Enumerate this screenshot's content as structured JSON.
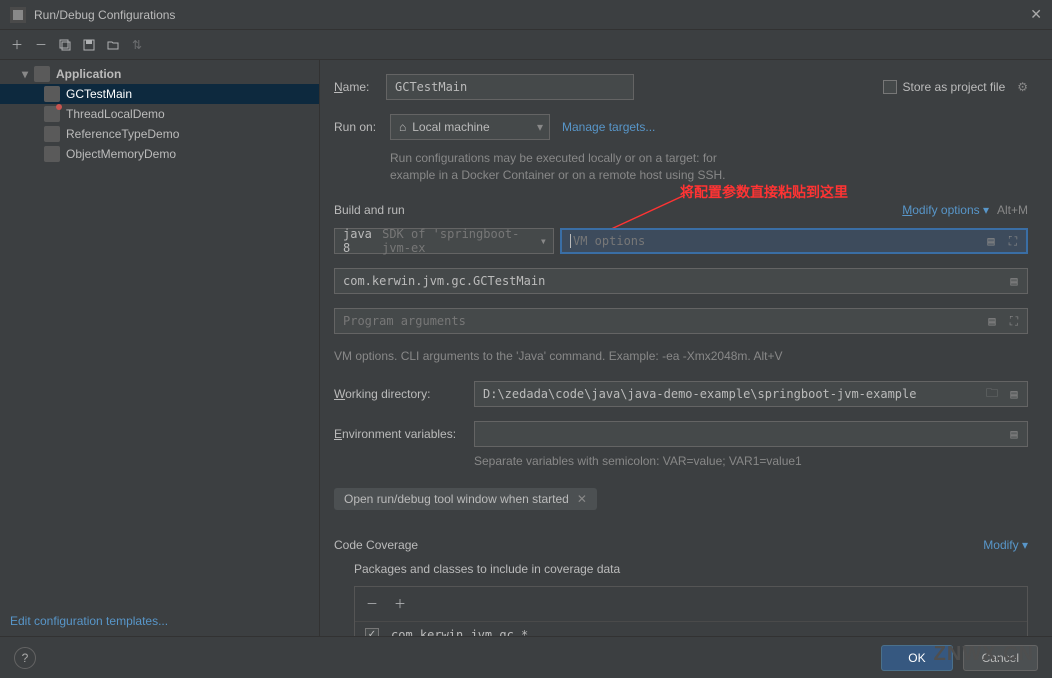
{
  "titlebar": {
    "title": "Run/Debug Configurations"
  },
  "tree": {
    "root": "Application",
    "items": [
      "GCTestMain",
      "ThreadLocalDemo",
      "ReferenceTypeDemo",
      "ObjectMemoryDemo"
    ]
  },
  "name": {
    "label": "Name:",
    "value": "GCTestMain"
  },
  "store_label": "Store as project file",
  "run_on": {
    "label": "Run on:",
    "value": "Local machine",
    "manage": "Manage targets...",
    "hint1": "Run configurations may be executed locally or on a target: for",
    "hint2": "example in a Docker Container or on a remote host using SSH."
  },
  "annotation_text": "将配置参数直接粘贴到这里",
  "build_run": {
    "title": "Build and run",
    "modify": "Modify options",
    "shortcut": "Alt+M",
    "sdk_prefix": "java 8 ",
    "sdk_rest": "SDK of 'springboot-jvm-ex",
    "vm_placeholder": "VM options",
    "main_class": "com.kerwin.jvm.gc.GCTestMain",
    "prog_args_placeholder": "Program arguments",
    "vm_hint": "VM options. CLI arguments to the 'Java' command. Example: -ea -Xmx2048m. Alt+V"
  },
  "wd": {
    "label": "Working directory:",
    "value": "D:\\zedada\\code\\java\\java-demo-example\\springboot-jvm-example"
  },
  "env": {
    "label": "Environment variables:",
    "hint": "Separate variables with semicolon: VAR=value; VAR1=value1"
  },
  "chip": "Open run/debug tool window when started",
  "coverage": {
    "title": "Code Coverage",
    "modify": "Modify",
    "subtitle": "Packages and classes to include in coverage data",
    "item": "com.kerwin.jvm.gc.*"
  },
  "edit_templates": "Edit configuration templates...",
  "buttons": {
    "ok": "OK",
    "cancel": "Cancel"
  },
  "watermark": "ZNWX.CN"
}
